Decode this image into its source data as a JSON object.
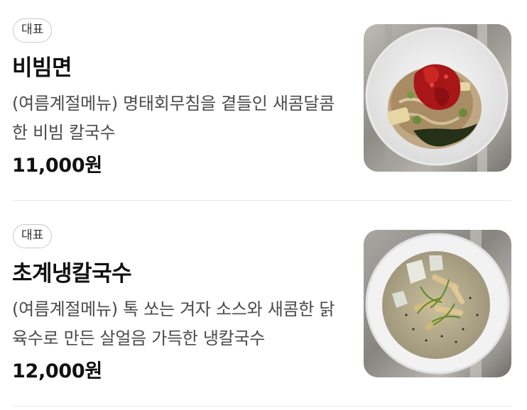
{
  "menu_items": [
    {
      "badge": "대표",
      "name": "비빔면",
      "description": "(여름계절메뉴) 명태회무침을 곁들인 새콤달콤한 비빔 칼국수",
      "price": "11,000원",
      "image": "bibim-noodle-bowl-photo"
    },
    {
      "badge": "대표",
      "name": "초계냉칼국수",
      "description": "(여름계절메뉴) 톡 쏘는 겨자 소스와 새콤한 닭육수로 만든 살얼음 가득한 냉칼국수",
      "price": "12,000원",
      "image": "chogye-cold-noodle-bowl-photo"
    }
  ]
}
